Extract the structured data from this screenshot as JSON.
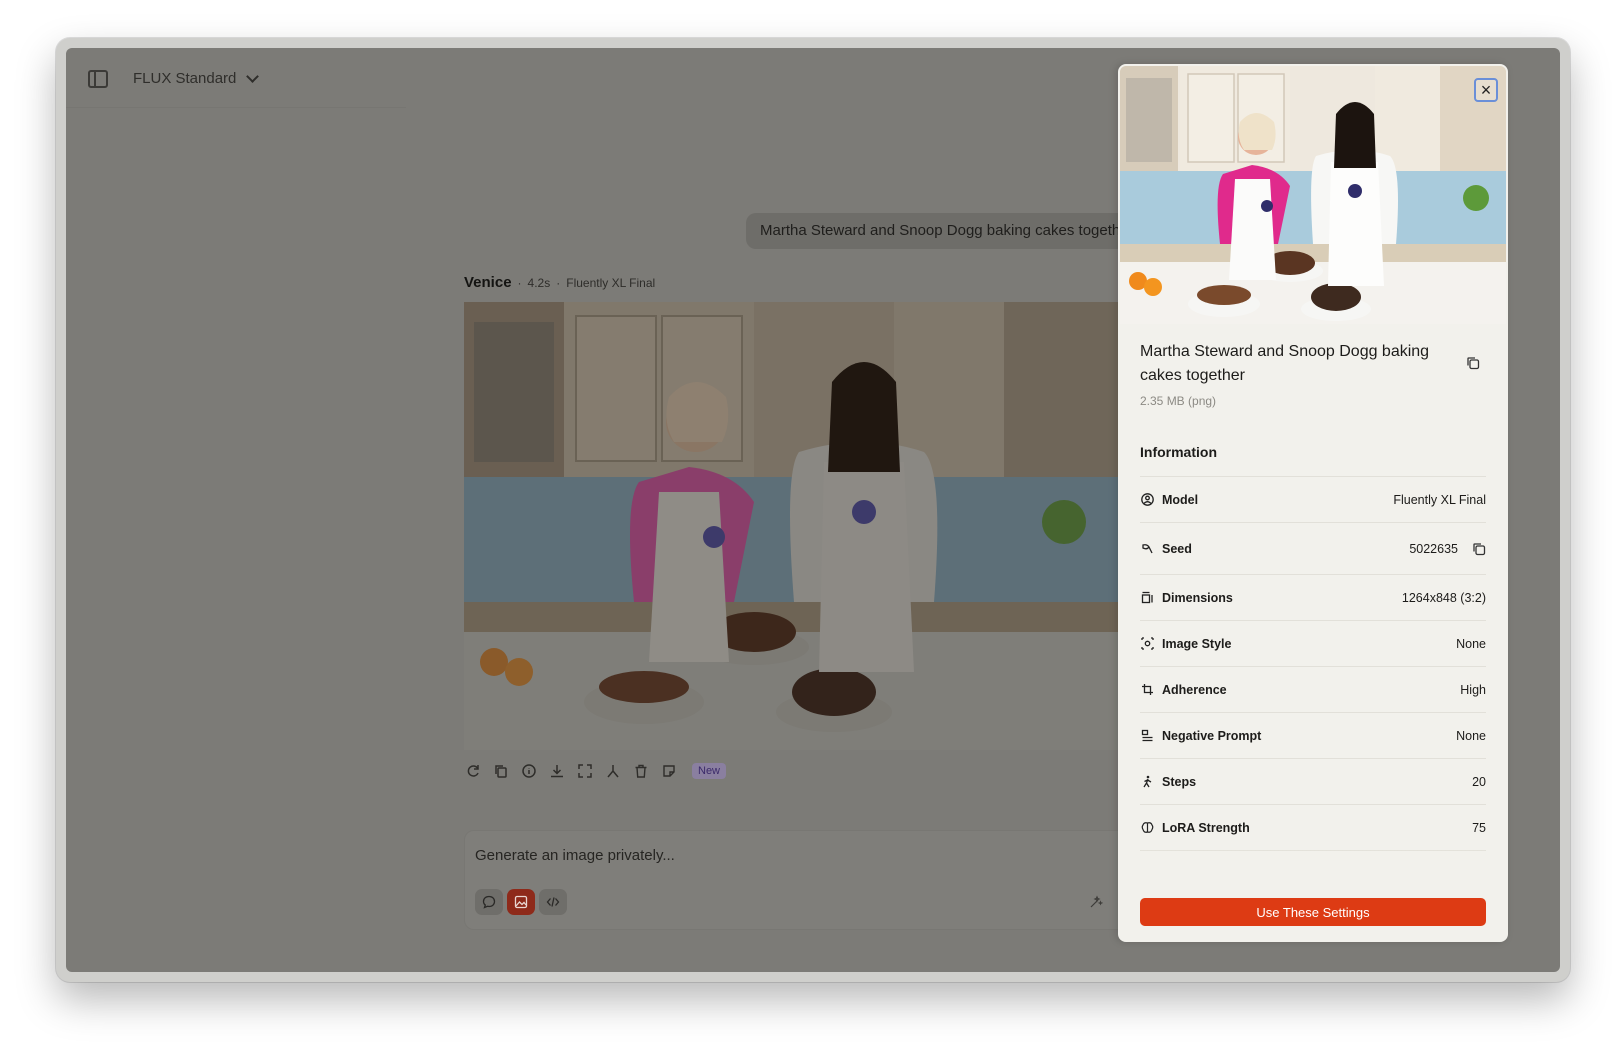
{
  "header": {
    "model_select": "FLUX Standard"
  },
  "chat": {
    "user_prompt": "Martha Steward and Snoop Dogg baking cakes together",
    "bot_name": "Venice",
    "bot_time": "4.2s",
    "bot_model": "Fluently XL Final",
    "new_badge": "New"
  },
  "input": {
    "placeholder": "Generate an image privately..."
  },
  "panel": {
    "prompt": "Martha Steward and Snoop Dogg baking cakes together",
    "file_size": "2.35 MB (png)",
    "info_heading": "Information",
    "rows": [
      {
        "label": "Model",
        "value": "Fluently XL Final"
      },
      {
        "label": "Seed",
        "value": "5022635"
      },
      {
        "label": "Dimensions",
        "value": "1264x848 (3:2)"
      },
      {
        "label": "Image Style",
        "value": "None"
      },
      {
        "label": "Adherence",
        "value": "High"
      },
      {
        "label": "Negative Prompt",
        "value": "None"
      },
      {
        "label": "Steps",
        "value": "20"
      },
      {
        "label": "LoRA Strength",
        "value": "75"
      }
    ],
    "use_settings": "Use These Settings"
  },
  "colors": {
    "accent": "#dd3b14",
    "overlay": "#7c7b77",
    "panel_bg": "#f2f1ec"
  }
}
